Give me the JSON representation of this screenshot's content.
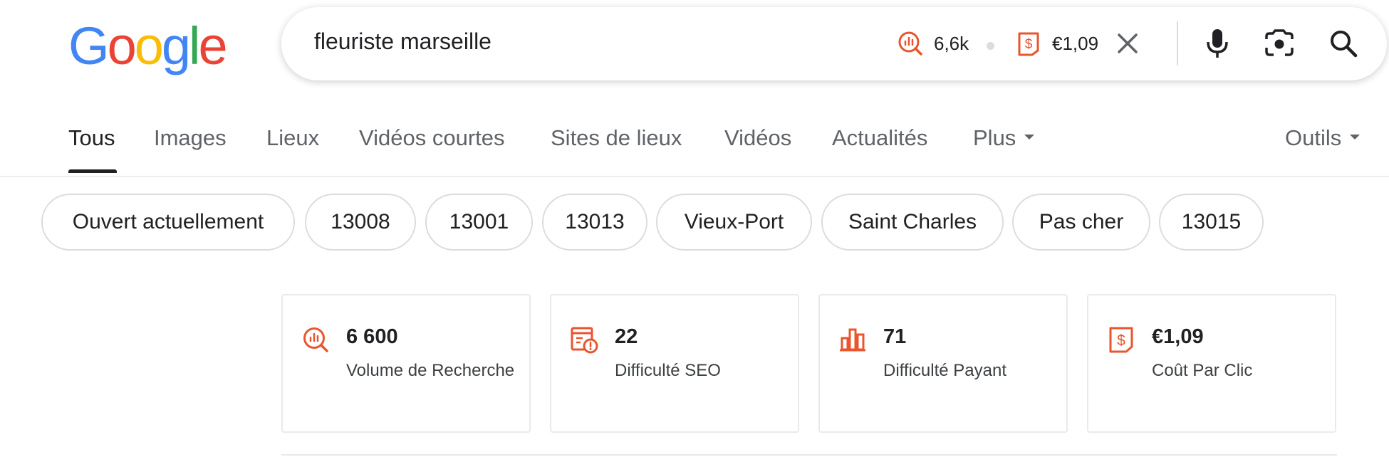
{
  "logo": {
    "letters": [
      "G",
      "o",
      "o",
      "g",
      "l",
      "e"
    ],
    "colors": [
      "#4285F4",
      "#EA4335",
      "#FBBC05",
      "#4285F4",
      "#34A853",
      "#EA4335"
    ]
  },
  "search": {
    "query": "fleuriste marseille",
    "volume_short": "6,6k",
    "cpc_short": "€1,09",
    "icons": [
      "volume-icon",
      "cpc-icon",
      "clear-icon",
      "mic-icon",
      "lens-icon",
      "search-icon"
    ]
  },
  "tabs": [
    "Tous",
    "Images",
    "Lieux",
    "Vidéos courtes",
    "Sites de lieux",
    "Vidéos",
    "Actualités",
    "Plus"
  ],
  "tools_label": "Outils",
  "chips": [
    "Ouvert actuellement",
    "13008",
    "13001",
    "13013",
    "Vieux-Port",
    "Saint Charles",
    "Pas cher",
    "13015"
  ],
  "metrics": [
    {
      "value": "6 600",
      "label": "Volume de Recherche",
      "icon": "volume-icon"
    },
    {
      "value": "22",
      "label": "Difficulté SEO",
      "icon": "seo-difficulty-icon"
    },
    {
      "value": "71",
      "label": "Difficulté Payant",
      "icon": "paid-difficulty-icon"
    },
    {
      "value": "€1,09",
      "label": "Coût Par Clic",
      "icon": "cpc-icon"
    }
  ],
  "colors": {
    "accent": "#E8552F",
    "text": "#202124",
    "muted": "#5f6368",
    "border": "#dadce0"
  }
}
